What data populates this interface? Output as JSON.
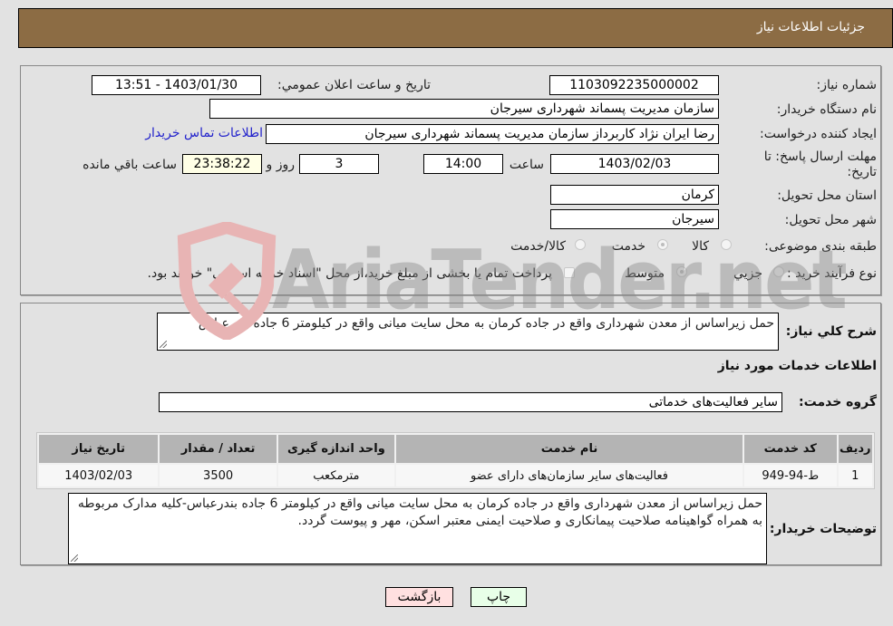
{
  "header": {
    "title": "جزئیات اطلاعات نیاز"
  },
  "details": {
    "need_number_label": "شماره نیاز:",
    "need_number": "1103092235000002",
    "announce_label": "تاریخ و ساعت اعلان عمومي:",
    "announce_value": "1403/01/30 - 13:51",
    "buyer_org_label": "نام دستگاه خریدار:",
    "buyer_org": "سازمان مدیریت پسماند شهرداری سیرجان",
    "requester_label": "ایجاد کننده درخواست:",
    "requester": "رضا ایران نژاد کاربرداز سازمان مدیریت پسماند شهرداری سیرجان",
    "contact_link": "اطلاعات تماس خریدار",
    "deadline_label_line1": "مهلت ارسال پاسخ: تا",
    "deadline_label_line2": "تاریخ:",
    "deadline_date": "1403/02/03",
    "time_label": "ساعت",
    "deadline_time": "14:00",
    "days_value": "3",
    "days_label": "روز و",
    "remaining_time": "23:38:22",
    "remaining_label": "ساعت باقي مانده",
    "province_label": "استان محل تحویل:",
    "province": "کرمان",
    "city_label": "شهر محل تحویل:",
    "city": "سیرجان",
    "category_label": "طبقه بندی موضوعی:",
    "category_options": [
      {
        "label": "کالا",
        "checked": false
      },
      {
        "label": "خدمت",
        "checked": true
      },
      {
        "label": "کالا/خدمت",
        "checked": false
      }
    ],
    "purchase_type_label": "نوع فرآیند خرید :",
    "purchase_type_options": [
      {
        "label": "جزیي",
        "checked": false
      },
      {
        "label": "متوسط",
        "checked": true
      }
    ],
    "treasury_note": "پرداخت تمام یا بخشی از مبلغ خرید،از محل \"اسناد خزانه اسلامی\" خواهد بود."
  },
  "description": {
    "label": "شرح کلي نیاز:",
    "value": "حمل زیراساس از معدن شهرداری واقع در جاده کرمان به محل سایت میانی واقع در کیلومتر 6 جاده بندرعباس"
  },
  "services": {
    "section_title": "اطلاعات خدمات مورد نیاز",
    "group_label": "گروه خدمت:",
    "group_value": "سایر فعالیت‌های خدماتی",
    "columns": [
      "ردیف",
      "کد خدمت",
      "نام خدمت",
      "واحد اندازه گیری",
      "تعداد / مقدار",
      "تاریخ نیاز"
    ],
    "rows": [
      [
        "1",
        "ط-94-949",
        "فعالیت‌های سایر سازمان‌های دارای عضو",
        "مترمکعب",
        "3500",
        "1403/02/03"
      ]
    ]
  },
  "buyer_notes": {
    "label": "توضیحات خریدار:",
    "value": "حمل زیراساس از معدن شهرداری واقع در جاده کرمان به محل سایت میانی واقع در کیلومتر 6 جاده بندرعباس-کلیه مدارک مربوطه به همراه گواهینامه صلاحیت پیمانکاری و صلاحیت ایمنی معتبر اسکن، مهر و پیوست گردد."
  },
  "buttons": {
    "print": "چاپ",
    "back": "بازگشت"
  },
  "watermark": {
    "text": "AriaTender.net"
  }
}
